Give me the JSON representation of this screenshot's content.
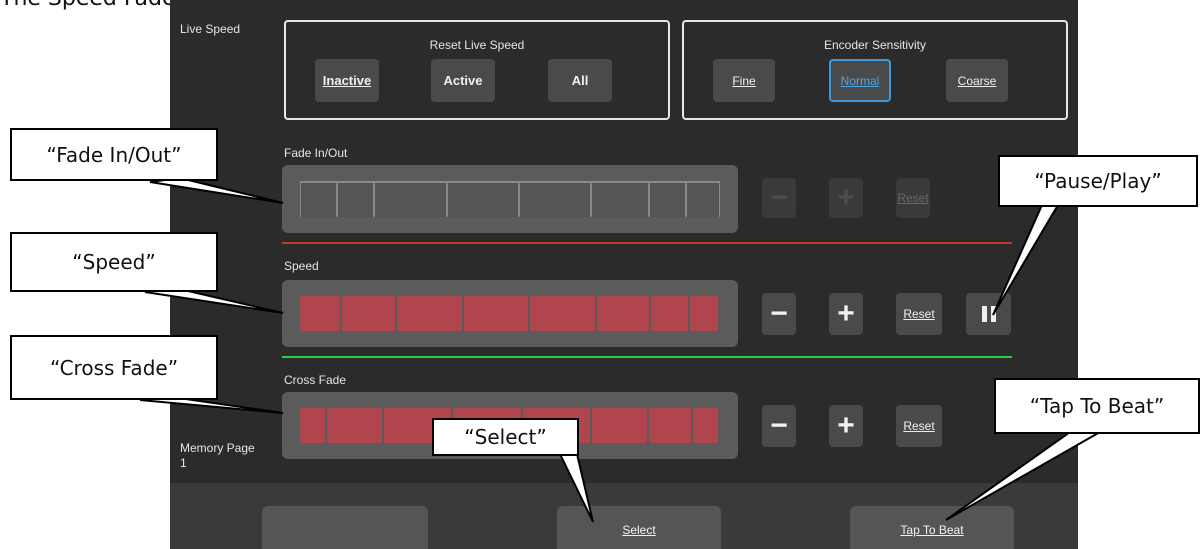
{
  "caption": "The Speed Fader Options",
  "side": {
    "live_speed": "Live Speed",
    "memory_page_label": "Memory Page",
    "memory_page_value": "1"
  },
  "reset_live_speed": {
    "title": "Reset Live Speed",
    "buttons": [
      "Inactive",
      "Active",
      "All"
    ]
  },
  "encoder_sensitivity": {
    "title": "Encoder Sensitivity",
    "buttons": [
      "Fine",
      "Normal",
      "Coarse"
    ],
    "selected": "Normal"
  },
  "sections": [
    {
      "label": "Fade In/Out",
      "minus": "−",
      "plus": "+",
      "reset": "Reset",
      "enabled": false
    },
    {
      "label": "Speed",
      "minus": "−",
      "plus": "+",
      "reset": "Reset",
      "enabled": true
    },
    {
      "label": "Cross Fade",
      "minus": "−",
      "plus": "+",
      "reset": "Reset",
      "enabled": true
    }
  ],
  "colors": {
    "speed_rule": "#c0392b",
    "cross_fade_rule": "#2ecc40",
    "selected": "#3a9ad9",
    "fader_fill": "#b0454d"
  },
  "bottom_bar": {
    "left": "",
    "select": "Select",
    "tap": "Tap To Beat"
  },
  "callouts": {
    "fade": "“Fade In/Out”",
    "speed": "“Speed”",
    "cross": "“Cross Fade”",
    "pause": "“Pause/Play”",
    "select": "“Select”",
    "tap": "“Tap To Beat”"
  },
  "icons": {
    "pause": "pause-icon",
    "minus": "minus-icon",
    "plus": "plus-icon"
  }
}
